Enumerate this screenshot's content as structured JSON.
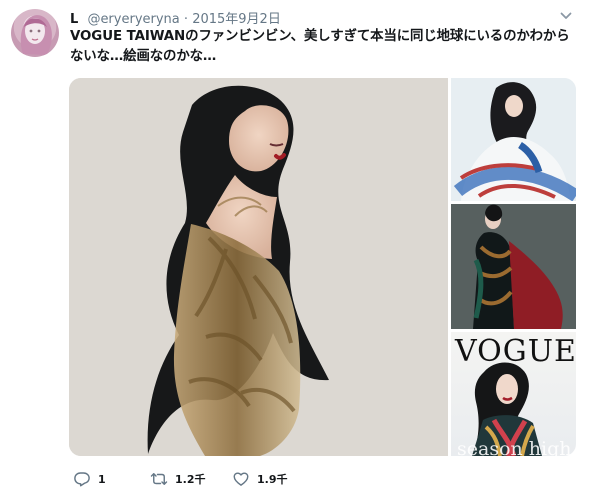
{
  "tweet": {
    "display_name": "L",
    "handle": "@eryeryeryna",
    "separator": "·",
    "date": "2015年9月2日",
    "text": "VOGUE TAIWANのファンビンビン、美しすぎて本当に同じ地球にいるのかわからないな…絵画なのかな…"
  },
  "media": {
    "cover_title": "VOGUE",
    "cover_text": "season high"
  },
  "actions": {
    "reply_count": "1",
    "retweet_count": "1.2千",
    "like_count": "1.9千"
  },
  "icons": {
    "reply": "reply-icon",
    "retweet": "retweet-icon",
    "like": "heart-icon",
    "more": "chevron-down-icon"
  },
  "colors": {
    "text": "#14171a",
    "secondary_text": "#657786",
    "background": "#ffffff"
  }
}
